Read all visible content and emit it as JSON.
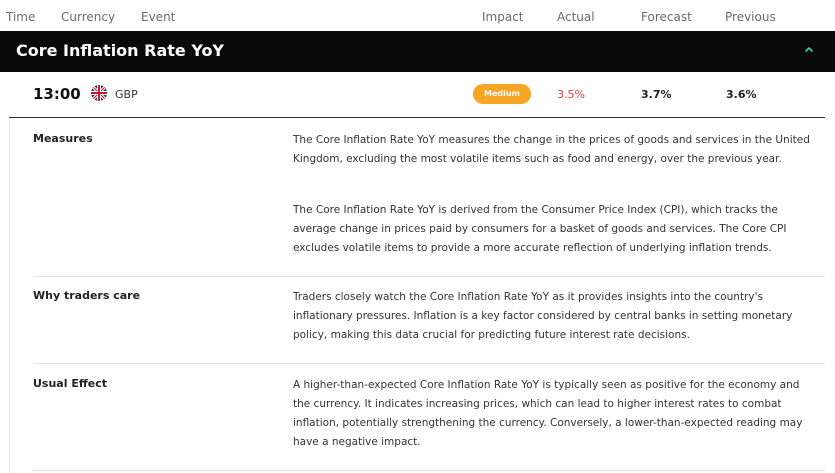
{
  "columns": {
    "time": "Time",
    "currency": "Currency",
    "event": "Event",
    "impact": "Impact",
    "actual": "Actual",
    "forecast": "Forecast",
    "previous": "Previous"
  },
  "event": {
    "title": "Core Inflation Rate YoY",
    "time": "13:00",
    "currency": "GBP",
    "flag_icon": "uk-flag-icon",
    "impact": "Medium",
    "actual": "3.5%",
    "forecast": "3.7%",
    "previous": "3.6%"
  },
  "colors": {
    "bar_bg": "#0a0a0a",
    "chevron": "#2ed3b0",
    "impact_medium": "#f6a623",
    "actual_text": "#e0403a"
  },
  "details": {
    "measures": {
      "label": "Measures",
      "p1": "The Core Inflation Rate YoY measures the change in the prices of goods and services in the United Kingdom, excluding the most volatile items such as food and energy, over the previous year.",
      "p2": "The Core Inflation Rate YoY is derived from the Consumer Price Index (CPI), which tracks the average change in prices paid by consumers for a basket of goods and services. The Core CPI excludes volatile items to provide a more accurate reflection of underlying inflation trends."
    },
    "why": {
      "label": "Why traders care",
      "p1": "Traders closely watch the Core Inflation Rate YoY as it provides insights into the country's inflationary pressures. Inflation is a key factor considered by central banks in setting monetary policy, making this data crucial for predicting future interest rate decisions."
    },
    "usual": {
      "label": "Usual Effect",
      "p1": "A higher-than-expected Core Inflation Rate YoY is typically seen as positive for the economy and the currency. It indicates increasing prices, which can lead to higher interest rates to combat inflation, potentially strengthening the currency. Conversely, a lower-than-expected reading may have a negative impact."
    }
  }
}
